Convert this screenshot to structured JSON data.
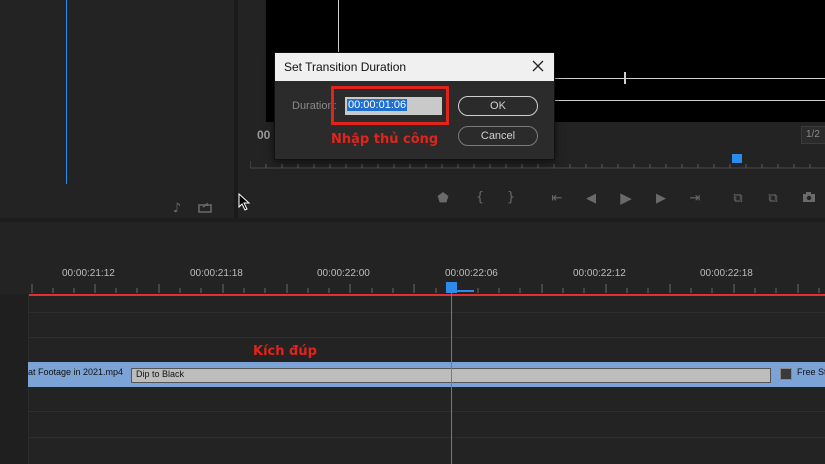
{
  "dialog": {
    "title": "Set Transition Duration",
    "duration_label": "Duration:",
    "duration_value": "00:00:01:06",
    "ok_label": "OK",
    "cancel_label": "Cancel"
  },
  "monitor": {
    "timecode_partial": "00",
    "zoom_partial": "1/2"
  },
  "timeline": {
    "ruler_labels": [
      "00:00:21:12",
      "00:00:21:18",
      "00:00:22:00",
      "00:00:22:06",
      "00:00:22:12",
      "00:00:22:18"
    ],
    "clip_left_name": "at Footage in 2021.mp4",
    "transition_name": "Dip to Black",
    "clip_right_name": "Free St"
  },
  "annotations": {
    "manual_input": "Nhập thủ công",
    "double_click": "Kích đúp"
  },
  "colors": {
    "annotation_red": "#e0241b",
    "playhead_blue": "#2d8ceb",
    "clip_blue": "#7ba3d6",
    "work_area_red": "#e03030"
  },
  "icons": [
    "marker-icon",
    "in-point-icon",
    "out-point-icon",
    "go-to-in-icon",
    "step-back-icon",
    "play-icon",
    "step-forward-icon",
    "go-to-out-icon",
    "insert-icon",
    "overwrite-icon",
    "camera-icon",
    "close-icon",
    "mouse-cursor-icon",
    "audio-icon",
    "export-icon",
    "fx-badge-icon"
  ]
}
